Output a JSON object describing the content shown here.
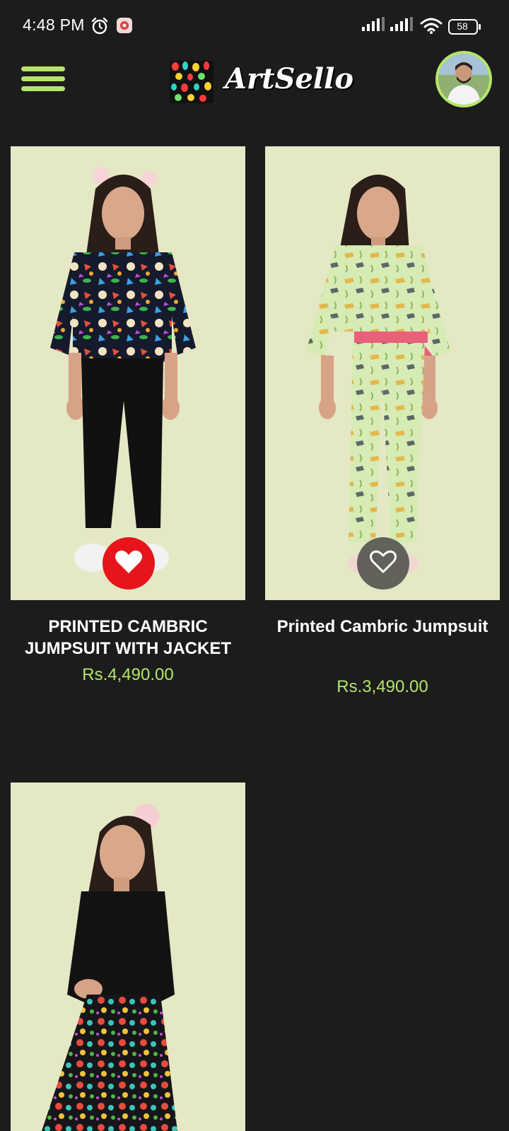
{
  "status_bar": {
    "time": "4:48 PM",
    "battery": "58",
    "icons": [
      "alarm-icon",
      "app-notification-icon",
      "signal-icon",
      "signal-icon",
      "wifi-icon",
      "battery-icon"
    ]
  },
  "header": {
    "app_name": "ArtSello",
    "menu_icon": "hamburger-menu-icon",
    "avatar": "user-avatar"
  },
  "colors": {
    "background": "#1c1c1c",
    "accent": "#b5e56b",
    "price": "#b5e56b",
    "favorite_active": "#e8141c",
    "image_background": "#e5e8c4"
  },
  "products": [
    {
      "title": "PRINTED CAMBRIC JUMPSUIT WITH JACKET",
      "price": "Rs.4,490.00",
      "favorite": true
    },
    {
      "title": "Printed Cambric Jumpsuit",
      "price": "Rs.3,490.00",
      "favorite": false
    },
    {
      "title": "",
      "price": "",
      "favorite": false
    }
  ]
}
